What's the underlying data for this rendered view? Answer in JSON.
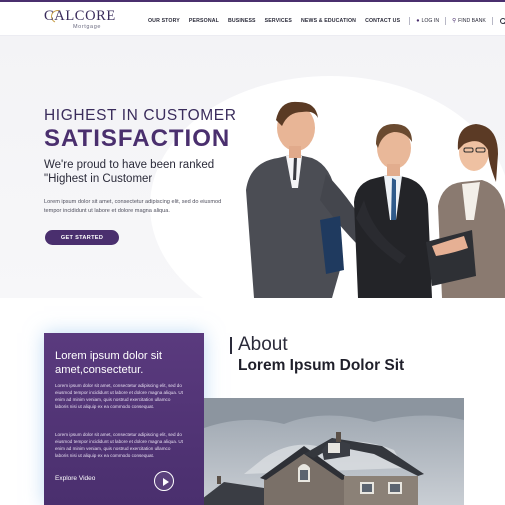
{
  "brand": {
    "logo_text": "CALCORE",
    "logo_subtext": "Mortgage"
  },
  "nav": {
    "items": [
      "OUR STORY",
      "PERSONAL",
      "BUSINESS",
      "SERVICES",
      "NEWS & EDUCATION",
      "CONTACT US"
    ],
    "login_label": "LOG IN",
    "find_bank_label": "FIND BANK",
    "login_icon": "user-icon",
    "find_bank_icon": "location-pin-icon",
    "search_icon": "search-icon"
  },
  "hero": {
    "eyebrow": "HIGHEST IN CUSTOMER",
    "title": "SATISFACTION",
    "subtitle": "We're proud to have been ranked \"Highest in Customer",
    "body": "Lorem ipsum dolor sit amet, consectetur adipiscing elit, sed do eiusmod tempor incididunt ut labore et dolore magna aliqua.",
    "cta_label": "GET STARTED"
  },
  "feature_card": {
    "title": "Lorem ipsum dolor sit amet,consectetur.",
    "paragraph_1": "Lorem ipsum dolor sit amet, consectetur adipiscing elit, sed do eiusmod tempor incididunt ut labore et dolore magna aliqua. Ut enim ad minim veniam, quis nostrud exercitation ullamco laboris nisi ut aliquip ex ea commodo consequat.",
    "paragraph_2": "Lorem ipsum dolor sit amet, consectetur adipiscing elit, sed do eiusmod tempor incididunt ut labore et dolore magna aliqua. Ut enim ad minim veniam, quis nostrud exercitation ullamco laboris nisi ut aliquip ex ea commodo consequat.",
    "explore_label": "Explore Video",
    "play_icon": "play-icon"
  },
  "about": {
    "label": "About",
    "title": "Lorem Ipsum Dolor Sit"
  },
  "colors": {
    "brand_purple": "#4a2f6e",
    "logo_gold": "#c9a04a",
    "text_dark": "#2b2b3a",
    "card_glow": "#8cbeeb"
  }
}
